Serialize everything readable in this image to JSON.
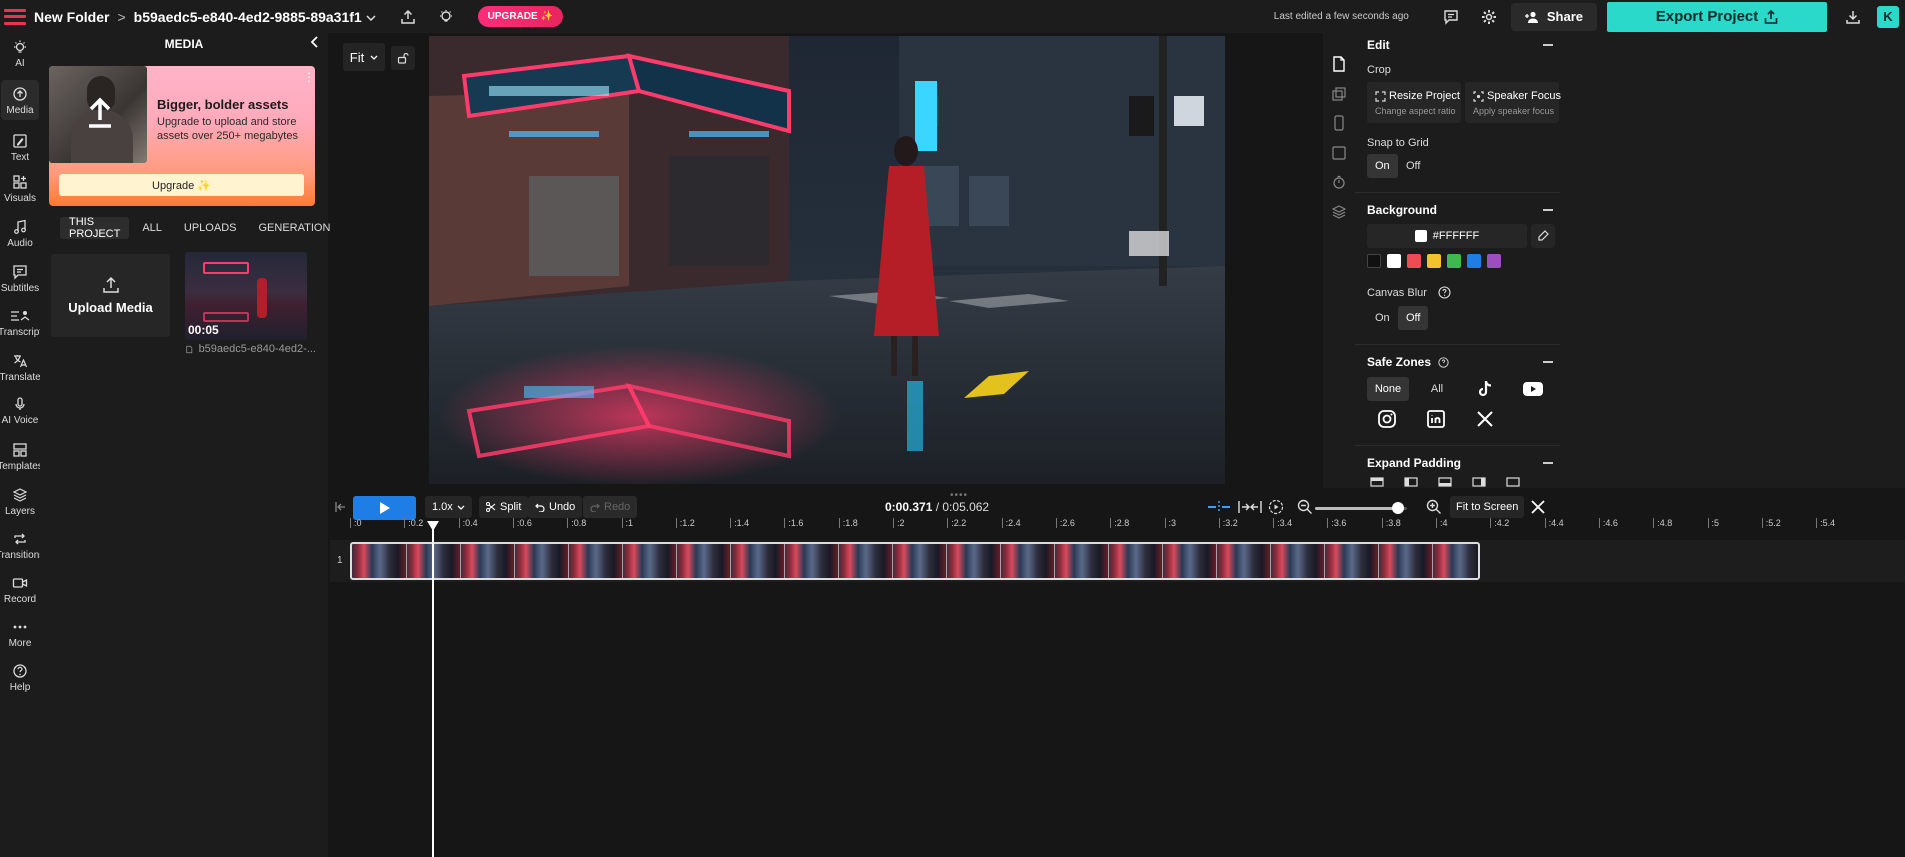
{
  "topbar": {
    "folder": "New Folder",
    "separator": ">",
    "filename": "b59aedc5-e840-4ed2-9885-89a31f1...",
    "upgrade": "UPGRADE ✨",
    "last_edited": "Last edited a few seconds ago",
    "share": "Share",
    "export": "Export Project",
    "avatar": "K"
  },
  "rail": [
    {
      "label": "AI",
      "icon": "lightbulb-icon"
    },
    {
      "label": "Media",
      "icon": "upload-icon"
    },
    {
      "label": "Text",
      "icon": "text-icon"
    },
    {
      "label": "Visuals",
      "icon": "visuals-icon"
    },
    {
      "label": "Audio",
      "icon": "music-icon"
    },
    {
      "label": "Subtitles",
      "icon": "subtitles-icon"
    },
    {
      "label": "Transcript",
      "icon": "transcript-icon"
    },
    {
      "label": "Translate",
      "icon": "translate-icon"
    },
    {
      "label": "AI Voice",
      "icon": "voice-icon"
    },
    {
      "label": "Templates",
      "icon": "templates-icon"
    },
    {
      "label": "Layers",
      "icon": "layers-icon"
    },
    {
      "label": "Transitions",
      "icon": "transitions-icon"
    },
    {
      "label": "Record",
      "icon": "record-icon"
    },
    {
      "label": "More",
      "icon": "more-icon"
    },
    {
      "label": "Help",
      "icon": "help-icon"
    }
  ],
  "media": {
    "title": "MEDIA",
    "promo_heading": "Bigger, bolder assets",
    "promo_text": "Upgrade to upload and store assets over 250+ megabytes",
    "promo_button": "Upgrade ✨",
    "tabs": [
      "THIS PROJECT",
      "ALL",
      "UPLOADS",
      "GENERATIONS"
    ],
    "upload_label": "Upload Media",
    "clip_duration": "00:05",
    "clip_name": "b59aedc5-e840-4ed2-..."
  },
  "stage": {
    "fit": "Fit"
  },
  "edit": {
    "title": "Edit",
    "crop_label": "Crop",
    "resize_title": "Resize Project",
    "resize_sub": "Change aspect ratio",
    "speaker_title": "Speaker Focus",
    "speaker_sub": "Apply speaker focus",
    "snap_label": "Snap to Grid",
    "on": "On",
    "off": "Off",
    "background_title": "Background",
    "bg_hex": "#FFFFFF",
    "swatches": [
      "#111111",
      "#ffffff",
      "#ef4b55",
      "#f2c12e",
      "#3fb94f",
      "#1e7ee6",
      "#9b4fbf"
    ],
    "canvas_blur_label": "Canvas Blur",
    "safe_zones_title": "Safe Zones",
    "none": "None",
    "all": "All",
    "expand_padding_title": "Expand Padding"
  },
  "timeline": {
    "speed": "1.0x",
    "split": "Split",
    "undo": "Undo",
    "redo": "Redo",
    "current_time": "0:00.371",
    "total_time": "/ 0:05.062",
    "zoom_level": 0.9,
    "fit_to_screen": "Fit to Screen",
    "track_number": "1",
    "ticks": [
      ":0",
      ":0.2",
      ":0.4",
      ":0.6",
      ":0.8",
      ":1",
      ":1.2",
      ":1.4",
      ":1.6",
      ":1.8",
      ":2",
      ":2.2",
      ":2.4",
      ":2.6",
      ":2.8",
      ":3",
      ":3.2",
      ":3.4",
      ":3.6",
      ":3.8",
      ":4",
      ":4.2",
      ":4.4",
      ":4.6",
      ":4.8",
      ":5",
      ":5.2",
      ":5.4"
    ]
  }
}
